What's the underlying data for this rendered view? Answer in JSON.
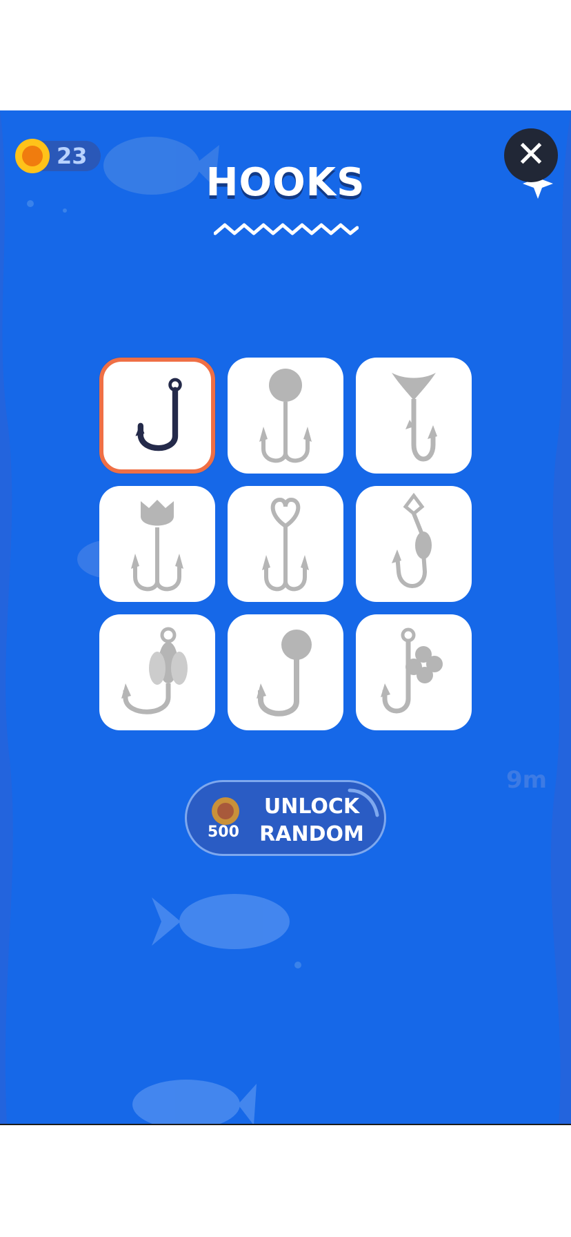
{
  "header": {
    "coins": "23",
    "title": "HOOKS",
    "close_symbol": "✕"
  },
  "icons": {
    "coin": "coin-icon",
    "close": "close-icon"
  },
  "hooks": [
    {
      "icon": "hook-classic-icon",
      "state": "selected"
    },
    {
      "icon": "hook-ball-treble-icon",
      "state": "locked"
    },
    {
      "icon": "hook-tail-icon",
      "state": "locked"
    },
    {
      "icon": "hook-tulip-treble-icon",
      "state": "locked"
    },
    {
      "icon": "hook-heart-treble-icon",
      "state": "locked"
    },
    {
      "icon": "hook-ring-bead-icon",
      "state": "locked"
    },
    {
      "icon": "hook-fly-icon",
      "state": "locked"
    },
    {
      "icon": "hook-jighead-icon",
      "state": "locked"
    },
    {
      "icon": "hook-clover-icon",
      "state": "locked"
    }
  ],
  "unlock": {
    "price": "500",
    "label_line1": "UNLOCK",
    "label_line2": "RANDOM"
  },
  "depth_label": "9m",
  "colors": {
    "background": "#1668e8",
    "selected_border": "#ef6f45",
    "locked_hook": "#b5b5b5",
    "active_hook": "#242a4a"
  }
}
